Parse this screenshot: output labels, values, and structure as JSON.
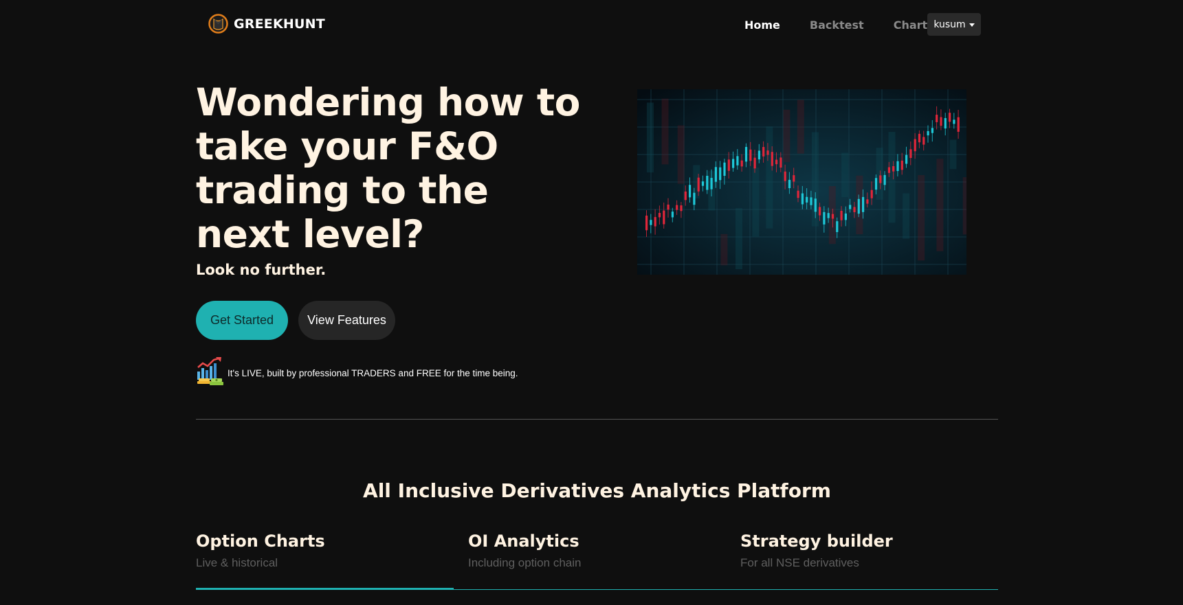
{
  "nav": {
    "brand": "GREEKHUNT",
    "links": [
      {
        "label": "Home",
        "active": true
      },
      {
        "label": "Backtest",
        "active": false
      },
      {
        "label": "Chart",
        "active": false
      }
    ],
    "user": "kusum",
    "user_icon": "caret-down-icon"
  },
  "hero": {
    "title": "Wondering how to take your F&O trading to the next level?",
    "subtitle": "Look no further.",
    "primary_button": "Get Started",
    "secondary_button": "View Features",
    "note": "It's LIVE, built by professional TRADERS and FREE for the time being.",
    "note_icon": "growth-money-icon",
    "image": "candlestick-chart-image"
  },
  "features": {
    "title": "All Inclusive Derivatives Analytics Platform",
    "tabs": [
      {
        "title": "Option Charts",
        "subtitle": "Live & historical",
        "active": true
      },
      {
        "title": "OI Analytics",
        "subtitle": "Including option chain",
        "active": false
      },
      {
        "title": "Strategy builder",
        "subtitle": "For all NSE derivatives",
        "active": false
      }
    ]
  },
  "colors": {
    "background": "#0f0f0f",
    "accent": "#1fb1b1",
    "text": "#fff3e2",
    "muted": "#5f5f5f",
    "candle_up": "#1ec8d8",
    "candle_down": "#e0263a"
  }
}
